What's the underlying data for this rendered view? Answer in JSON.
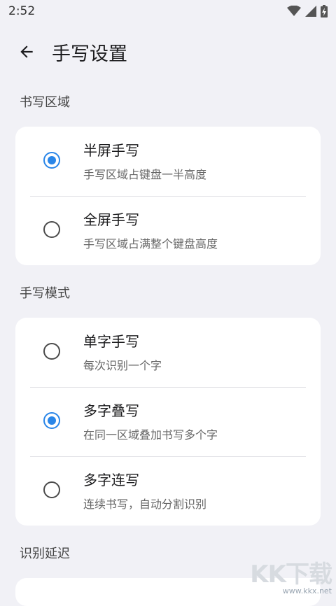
{
  "status": {
    "time": "2:52"
  },
  "header": {
    "title": "手写设置"
  },
  "sections": [
    {
      "title": "书写区域",
      "options": [
        {
          "title": "半屏手写",
          "subtitle": "手写区域占键盘一半高度",
          "checked": true
        },
        {
          "title": "全屏手写",
          "subtitle": "手写区域占满整个键盘高度",
          "checked": false
        }
      ]
    },
    {
      "title": "手写模式",
      "options": [
        {
          "title": "单字手写",
          "subtitle": "每次识别一个字",
          "checked": false
        },
        {
          "title": "多字叠写",
          "subtitle": "在同一区域叠加书写多个字",
          "checked": true
        },
        {
          "title": "多字连写",
          "subtitle": "连续书写，自动分割识别",
          "checked": false
        }
      ]
    },
    {
      "title": "识别延迟"
    }
  ],
  "watermark": {
    "logo": "KK下载",
    "url": "www.kkx.net"
  },
  "colors": {
    "accent": "#2a86e8",
    "background": "#f1f1f6"
  }
}
